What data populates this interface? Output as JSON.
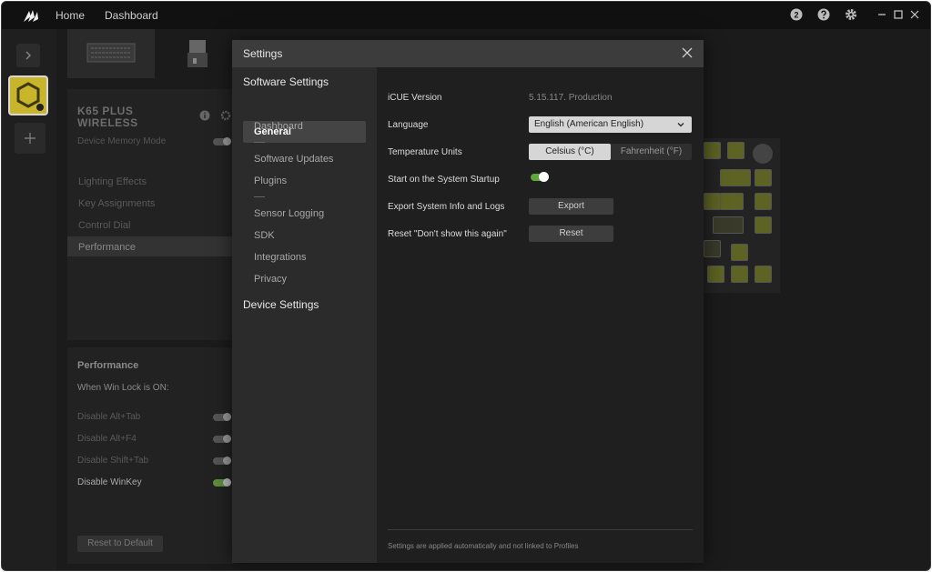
{
  "titlebar": {
    "nav": [
      "Home",
      "Dashboard"
    ],
    "icons": [
      "notifications-icon",
      "help-icon",
      "gear-icon",
      "minimize-icon",
      "maximize-icon",
      "close-icon"
    ],
    "notification_count": "2"
  },
  "device": {
    "name": "K65 PLUS WIRELESS",
    "memory_mode_label": "Device Memory Mode",
    "menu": [
      "Lighting Effects",
      "Key Assignments",
      "Control Dial",
      "Performance"
    ],
    "active_menu": "Performance"
  },
  "performance": {
    "title": "Performance",
    "subtitle": "When Win Lock is ON:",
    "options": [
      {
        "label": "Disable Alt+Tab",
        "on": false
      },
      {
        "label": "Disable Alt+F4",
        "on": false
      },
      {
        "label": "Disable Shift+Tab",
        "on": false
      },
      {
        "label": "Disable WinKey",
        "on": true
      }
    ],
    "reset_label": "Reset to Default"
  },
  "dialog": {
    "title": "Settings",
    "nav": {
      "software_settings": "Software Settings",
      "items": [
        "General",
        "Dashboard",
        "Software Updates",
        "Plugins",
        "Sensor Logging",
        "SDK",
        "Integrations",
        "Privacy"
      ],
      "active": "General",
      "device_settings": "Device Settings"
    },
    "general": {
      "icue_version_label": "iCUE Version",
      "icue_version_value": "5.15.117. Production",
      "language_label": "Language",
      "language_value": "English (American English)",
      "temperature_label": "Temperature Units",
      "temperature_options": [
        "Celsius (°C)",
        "Fahrenheit (°F)"
      ],
      "temperature_selected": "Celsius (°C)",
      "startup_label": "Start on the System Startup",
      "startup_on": true,
      "export_label": "Export System Info and Logs",
      "export_button": "Export",
      "reset_label": "Reset \"Don't show this again\"",
      "reset_button": "Reset"
    },
    "footer_note": "Settings are applied automatically and not linked to Profiles"
  },
  "colors": {
    "accent_green": "#5ea73a",
    "device_yellow": "#c9b52c"
  }
}
